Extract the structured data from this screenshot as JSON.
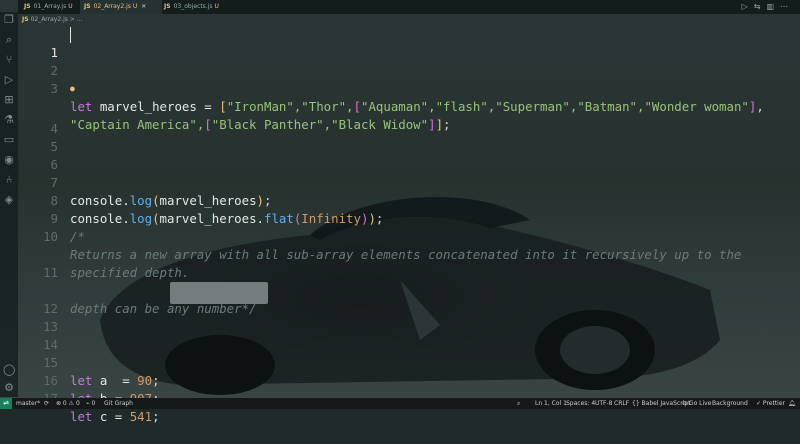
{
  "tabs": [
    {
      "name": "01_Array.js",
      "badge": "U",
      "active": false
    },
    {
      "name": "02_Array2.js",
      "badge": "U",
      "active": true
    },
    {
      "name": "03_objects.js",
      "badge": "U",
      "active": false
    }
  ],
  "tab_js_label": "JS",
  "close_glyph": "✕",
  "breadcrumb": {
    "file": "02_Array2.js",
    "sep": ">",
    "trail": "..."
  },
  "editor": {
    "line_numbers": [
      "1",
      "2",
      "3",
      "",
      "4",
      "5",
      "6",
      "7",
      "8",
      "9",
      "10",
      "",
      "11",
      "",
      "12",
      "13",
      "14",
      "15",
      "16",
      "17",
      "18",
      "19"
    ],
    "line1_text": "",
    "line3a": {
      "kw": "let",
      "rest": " marvel_heroes = "
    },
    "line3a_items": "\"IronMan\",\"Thor\",",
    "line3a_items2": "\"Aquaman\",\"flash\",\"Superman\",\"Batman\",\"Wonder woman\"",
    "line3b_items": "\"Captain America\",",
    "line3b_items2": "\"Black Panther\",\"Black Widow\"",
    "line7": {
      "obj": "console.",
      "fn": "log",
      "arg": "marvel_heroes"
    },
    "line8": {
      "obj": "console.",
      "fn": "log",
      "arg": "marvel_heroes.",
      "fn2": "flat",
      "arg2": "Infinity"
    },
    "comment_open": "/*",
    "comment_10a": "Returns a new array with all sub-array elements concatenated into it recursively up to the",
    "comment_10b": "specified depth.",
    "comment_12": "depth can be any number*/",
    "line16": {
      "kw": "let",
      "name": " a  = ",
      "num": "90"
    },
    "line17": {
      "kw": "let",
      "name": " b = ",
      "num": "907"
    },
    "line18": {
      "kw": "let",
      "name": " c = ",
      "num": "541"
    }
  },
  "status": {
    "remote_icon": "remote-icon",
    "branch": "master*",
    "sync": "⟳",
    "problems": "⊗ 0 ⚠ 0",
    "ports": "⌁ 0",
    "git_graph": "Git Graph",
    "position": "Ln 1, Col 1",
    "spaces": "Spaces: 4",
    "encoding": "UTF-8",
    "eol": "CRLF",
    "language": "{} Babel JavaScript",
    "golive": "⊙ Go Live",
    "background": "Background",
    "prettier": "✓ Prettier"
  }
}
